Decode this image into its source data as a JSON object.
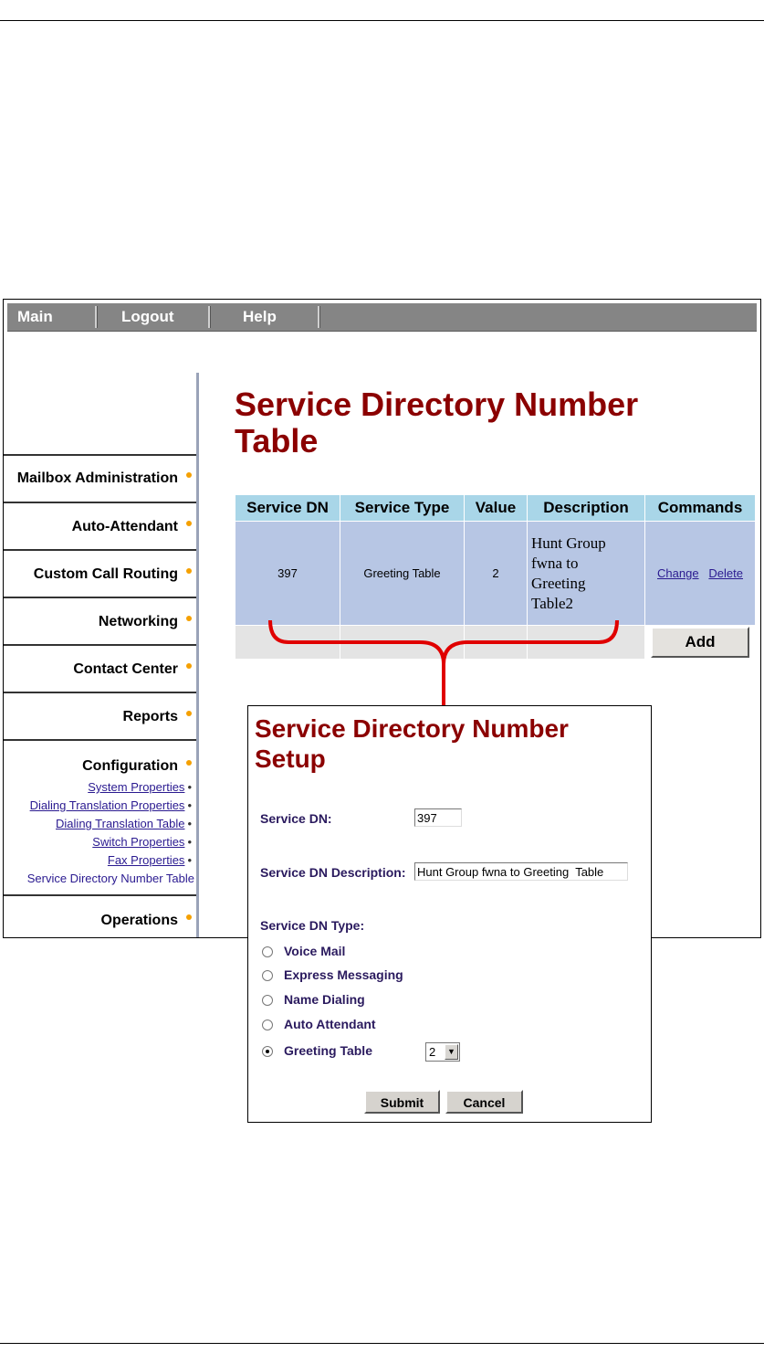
{
  "navbar": {
    "items": [
      "Main",
      "Logout",
      "Help"
    ]
  },
  "sidebar": {
    "mailbox": "Mailbox Administration",
    "auto_attendant": "Auto-Attendant",
    "custom_call_routing": "Custom Call Routing",
    "networking": "Networking",
    "contact_center": "Contact Center",
    "reports": "Reports",
    "configuration": "Configuration",
    "config_sub": [
      "System Properties",
      "Dialing Translation Properties",
      "Dialing Translation Table",
      "Switch Properties",
      "Fax Properties",
      "Service Directory Number Table"
    ],
    "operations": "Operations"
  },
  "main": {
    "title_line1": "Service Directory Number",
    "title_line2": "Table",
    "table": {
      "headers": [
        "Service DN",
        "Service Type",
        "Value",
        "Description",
        "Commands"
      ],
      "rows": [
        {
          "service_dn": "397",
          "service_type": "Greeting Table",
          "value": "2",
          "description": [
            "Hunt Group",
            "fwna to",
            "Greeting",
            "Table2"
          ],
          "change": "Change",
          "delete": "Delete"
        }
      ],
      "add_label": "Add"
    }
  },
  "dialog": {
    "title_line1": "Service Directory Number",
    "title_line2": "Setup",
    "service_dn_label": "Service DN:",
    "service_dn_value": "397",
    "description_label": "Service DN Description:",
    "description_value": "Hunt Group fwna to Greeting  Table",
    "type_label": "Service DN Type:",
    "types": [
      "Voice Mail",
      "Express Messaging",
      "Name Dialing",
      "Auto Attendant",
      "Greeting Table"
    ],
    "selected_type": "Greeting Table",
    "greeting_table_value": "2",
    "submit_label": "Submit",
    "cancel_label": "Cancel"
  },
  "colors": {
    "title": "#8b0000",
    "header_bg": "#a9d6e8",
    "row_bg": "#b7c6e4",
    "brace": "#e00000",
    "nav_bg": "#858585",
    "bullet": "#f5a000"
  }
}
